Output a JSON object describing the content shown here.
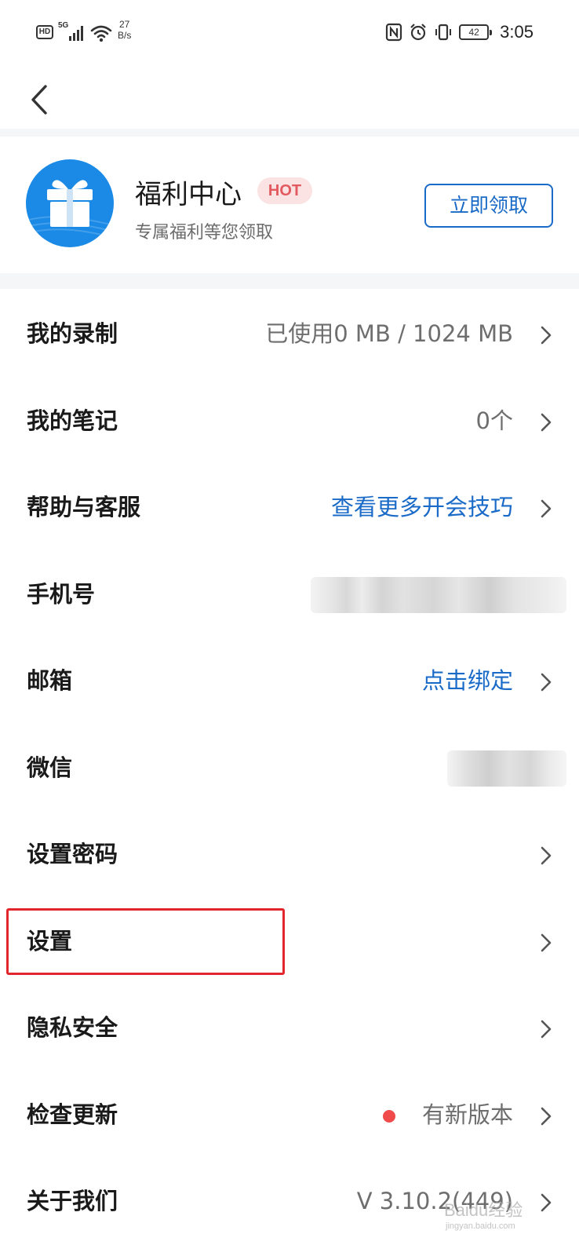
{
  "status_bar": {
    "hd_label": "HD",
    "network_label": "5G",
    "speed_value": "27",
    "speed_unit": "B/s",
    "battery_level": "42",
    "time": "3:05"
  },
  "welfare": {
    "title": "福利中心",
    "badge": "HOT",
    "subtitle": "专属福利等您领取",
    "button_label": "立即领取"
  },
  "menu": {
    "recording": {
      "label": "我的录制",
      "value": "已使用0 MB / 1024 MB"
    },
    "notes": {
      "label": "我的笔记",
      "value": "0个"
    },
    "help": {
      "label": "帮助与客服",
      "value": "查看更多开会技巧"
    },
    "phone": {
      "label": "手机号"
    },
    "email": {
      "label": "邮箱",
      "value": "点击绑定"
    },
    "wechat": {
      "label": "微信"
    },
    "password": {
      "label": "设置密码"
    },
    "settings": {
      "label": "设置"
    },
    "privacy": {
      "label": "隐私安全"
    },
    "update": {
      "label": "检查更新",
      "value": "有新版本"
    },
    "about": {
      "label": "关于我们",
      "value": "V 3.10.2(449)"
    }
  },
  "watermark": {
    "text": "Baidu经验",
    "sub": "jingyan.baidu.com"
  },
  "colors": {
    "accent_blue": "#1a6ac8",
    "gift_blue": "#1a8ae6",
    "hot_red": "#e25a5f",
    "highlight_red": "#e3262e",
    "dot_red": "#f04a4a"
  }
}
